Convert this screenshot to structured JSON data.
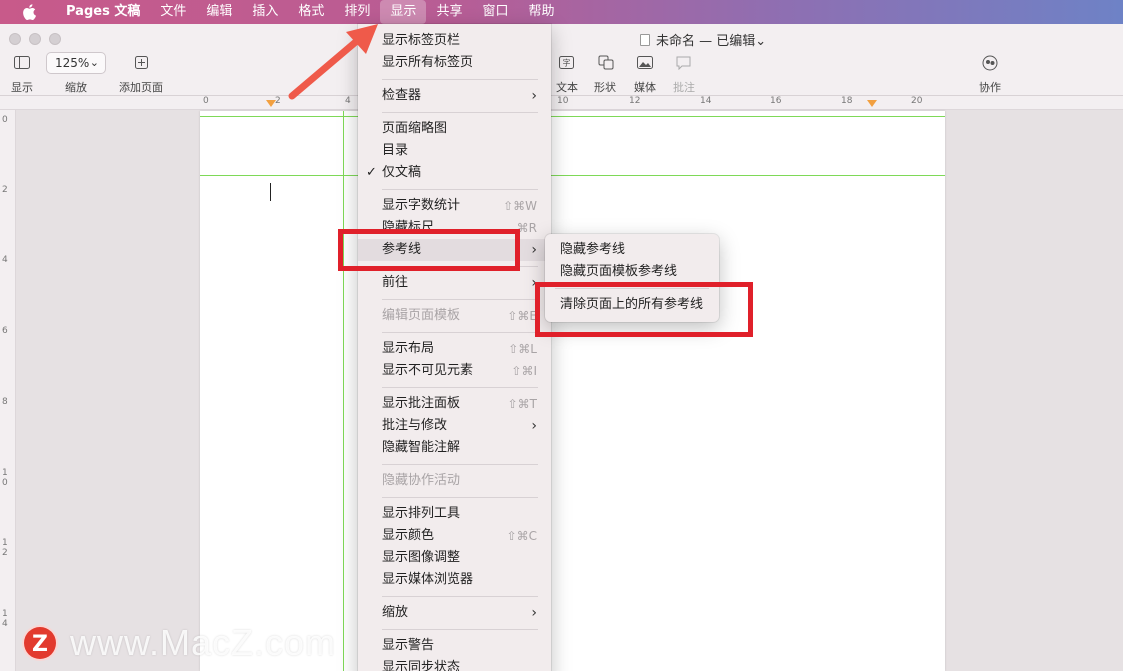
{
  "menubar": {
    "items": [
      "Pages 文稿",
      "文件",
      "编辑",
      "插入",
      "格式",
      "排列",
      "显示",
      "共享",
      "窗口",
      "帮助"
    ],
    "active_index": 6
  },
  "window": {
    "title": "未命名 — 已编辑",
    "toolbar": {
      "view_label": "显示",
      "zoom_value": "125%",
      "zoom_label": "缩放",
      "add_page_label": "添加页面",
      "text_label": "文本",
      "shape_label": "形状",
      "media_label": "媒体",
      "comment_label": "批注",
      "collab_label": "协作"
    }
  },
  "ruler": {
    "horizontal": [
      "0",
      "2",
      "4",
      "10",
      "12",
      "14",
      "16",
      "18",
      "20"
    ],
    "vertical": [
      "0",
      "2",
      "4",
      "6",
      "8",
      "1\n0",
      "1\n2",
      "1\n4"
    ]
  },
  "view_menu": {
    "items": [
      {
        "label": "显示标签页栏"
      },
      {
        "label": "显示所有标签页"
      },
      {
        "label": "检查器",
        "submenu": true
      },
      {
        "label": "页面缩略图"
      },
      {
        "label": "目录"
      },
      {
        "label": "仅文稿",
        "checked": true
      },
      {
        "label": "显示字数统计",
        "shortcut": "⇧⌘W"
      },
      {
        "label": "隐藏标尺",
        "shortcut": "⌘R"
      },
      {
        "label": "参考线",
        "submenu": true,
        "highlighted": true
      },
      {
        "label": "前往",
        "submenu": true
      },
      {
        "label": "编辑页面模板",
        "shortcut": "⇧⌘E",
        "disabled": true
      },
      {
        "label": "显示布局",
        "shortcut": "⇧⌘L"
      },
      {
        "label": "显示不可见元素",
        "shortcut": "⇧⌘I"
      },
      {
        "label": "显示批注面板",
        "shortcut": "⇧⌘T"
      },
      {
        "label": "批注与修改",
        "submenu": true
      },
      {
        "label": "隐藏智能注解"
      },
      {
        "label": "隐藏协作活动",
        "disabled": true
      },
      {
        "label": "显示排列工具"
      },
      {
        "label": "显示颜色",
        "shortcut": "⇧⌘C"
      },
      {
        "label": "显示图像调整"
      },
      {
        "label": "显示媒体浏览器"
      },
      {
        "label": "缩放",
        "submenu": true
      },
      {
        "label": "显示警告"
      },
      {
        "label": "显示同步状态"
      }
    ]
  },
  "guides_submenu": {
    "items": [
      "隐藏参考线",
      "隐藏页面模板参考线",
      "清除页面上的所有参考线"
    ]
  },
  "annotation_color": "#e0202a",
  "guide_color": "#7ed957",
  "watermark": {
    "text": "www.MacZ.com",
    "logo": "Z"
  }
}
